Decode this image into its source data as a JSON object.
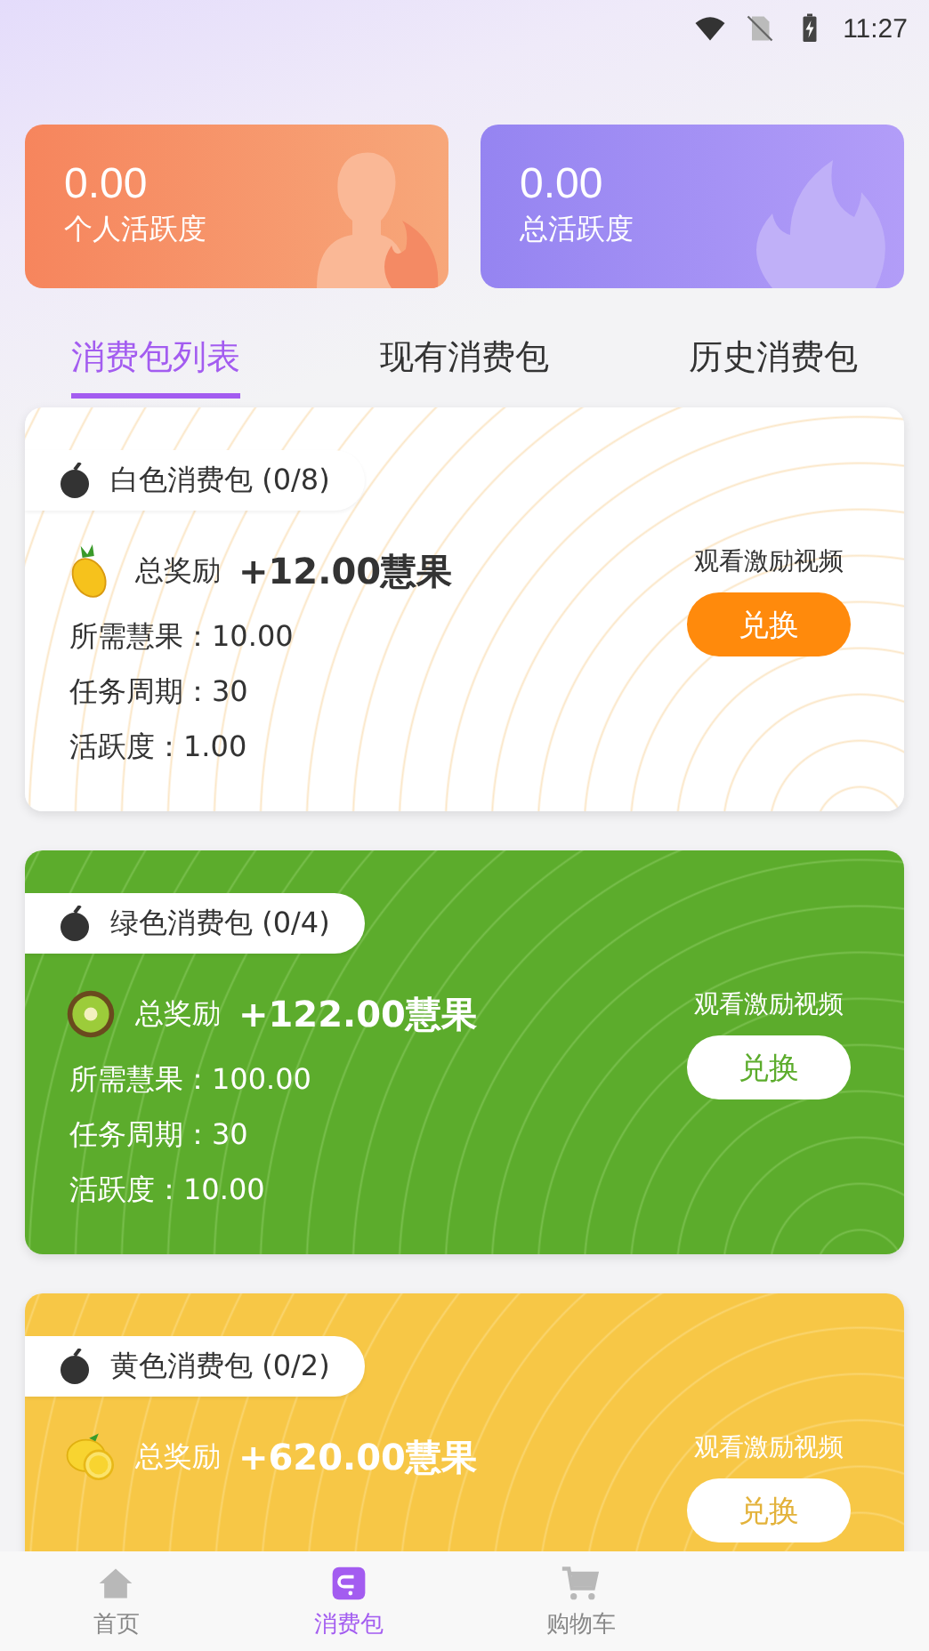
{
  "status_bar": {
    "time": "11:27"
  },
  "stats": [
    {
      "kind": "personal",
      "value": "0.00",
      "label": "个人活跃度"
    },
    {
      "kind": "total",
      "value": "0.00",
      "label": "总活跃度"
    }
  ],
  "tabs": [
    {
      "label": "消费包列表",
      "selected": true
    },
    {
      "label": "现有消费包",
      "selected": false
    },
    {
      "label": "历史消费包",
      "selected": false
    }
  ],
  "packages": [
    {
      "kind": "white",
      "title": "白色消费包 (0/8)",
      "reward_label": "总奖励",
      "reward": "+12.00慧果",
      "video_label": "观看激励视频",
      "button": "兑换",
      "details": [
        "所需慧果：10.00",
        "任务周期：30",
        "活跃度：1.00"
      ]
    },
    {
      "kind": "green",
      "title": "绿色消费包 (0/4)",
      "reward_label": "总奖励",
      "reward": "+122.00慧果",
      "video_label": "观看激励视频",
      "button": "兑换",
      "details": [
        "所需慧果：100.00",
        "任务周期：30",
        "活跃度：10.00"
      ]
    },
    {
      "kind": "yellow",
      "title": "黄色消费包 (0/2)",
      "reward_label": "总奖励",
      "reward": "+620.00慧果",
      "video_label": "观看激励视频",
      "button": "兑换"
    }
  ],
  "nav": [
    {
      "kind": "home",
      "label": "首页",
      "selected": false
    },
    {
      "kind": "package",
      "label": "消费包",
      "selected": true
    },
    {
      "kind": "cart",
      "label": "购物车",
      "selected": false
    }
  ]
}
